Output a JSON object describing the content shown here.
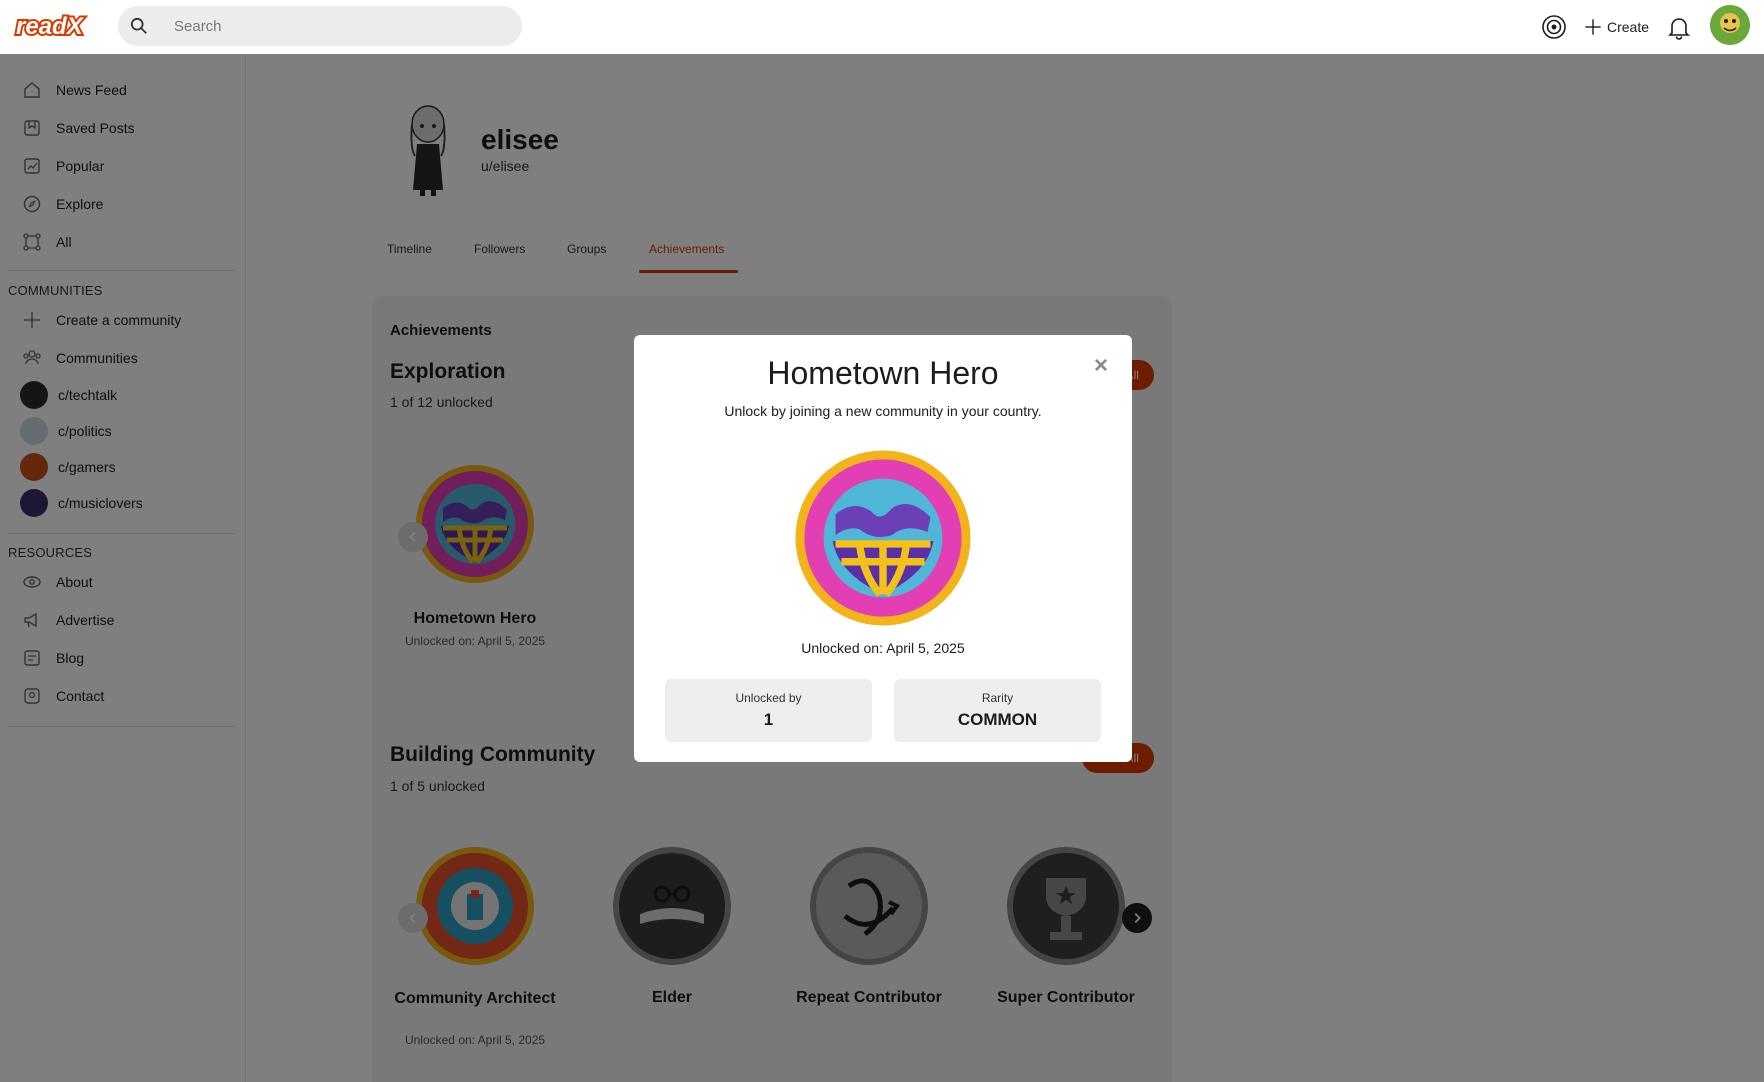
{
  "app": {
    "logo_text": "readX",
    "brand_color": "#d93a00"
  },
  "search": {
    "placeholder": "Search"
  },
  "topbar": {
    "create_label": "Create"
  },
  "sidebar": {
    "nav": [
      {
        "label": "News Feed",
        "icon": "home-icon"
      },
      {
        "label": "Saved Posts",
        "icon": "bookmark-icon"
      },
      {
        "label": "Popular",
        "icon": "trending-icon"
      },
      {
        "label": "Explore",
        "icon": "compass-icon"
      },
      {
        "label": "All",
        "icon": "grid-icon"
      }
    ],
    "communities_label": "COMMUNITIES",
    "create_community": "Create a community",
    "communities_link": "Communities",
    "communities": [
      {
        "label": "c/techtalk",
        "color": "#2b2b2b"
      },
      {
        "label": "c/politics",
        "color": "#cfd8e3"
      },
      {
        "label": "c/gamers",
        "color": "#c9511f"
      },
      {
        "label": "c/musiclovers",
        "color": "#3a2f6b"
      }
    ],
    "resources_label": "RESOURCES",
    "resources": [
      {
        "label": "About",
        "icon": "eye-icon"
      },
      {
        "label": "Advertise",
        "icon": "megaphone-icon"
      },
      {
        "label": "Blog",
        "icon": "blog-icon"
      },
      {
        "label": "Contact",
        "icon": "contact-icon"
      }
    ]
  },
  "profile": {
    "name": "elisee",
    "handle": "u/elisee"
  },
  "tabs": [
    "Timeline",
    "Followers",
    "Groups",
    "Achievements"
  ],
  "achievements": {
    "heading": "Achievements",
    "view_all": "View All",
    "categories": [
      {
        "title": "Exploration",
        "subtitle": "1 of 12 unlocked",
        "badges": [
          {
            "name": "Hometown Hero",
            "date": "Unlocked on: April 5, 2025"
          }
        ]
      },
      {
        "title": "Building Community",
        "subtitle": "1 of 5 unlocked",
        "badges": [
          {
            "name": "Community Architect",
            "date": "Unlocked on: April 5, 2025"
          },
          {
            "name": "Elder",
            "date": ""
          },
          {
            "name": "Repeat Contributor",
            "date": ""
          },
          {
            "name": "Super Contributor",
            "date": ""
          }
        ]
      }
    ]
  },
  "modal": {
    "title": "Hometown Hero",
    "description": "Unlock by joining a new community in your country.",
    "date": "Unlocked on: April 5, 2025",
    "close_glyph": "×",
    "unlocked_by_label": "Unlocked by",
    "unlocked_by_value": "1",
    "rarity_label": "Rarity",
    "rarity_value": "COMMON"
  }
}
